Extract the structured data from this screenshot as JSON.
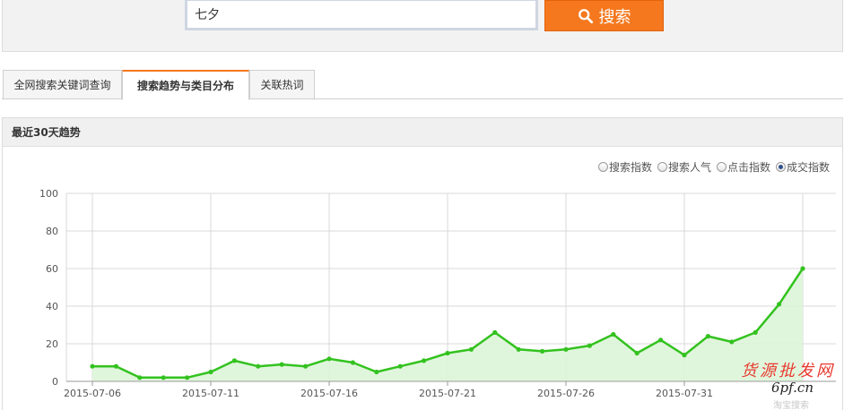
{
  "search": {
    "value": "七夕",
    "button_label": "搜索"
  },
  "tabs": [
    {
      "label": "全网搜索关键词查询",
      "active": false
    },
    {
      "label": "搜索趋势与类目分布",
      "active": true
    },
    {
      "label": "关联热词",
      "active": false
    }
  ],
  "trend": {
    "title": "最近30天趋势",
    "metric_options": [
      {
        "label": "搜索指数",
        "checked": false
      },
      {
        "label": "搜索人气",
        "checked": false
      },
      {
        "label": "点击指数",
        "checked": false
      },
      {
        "label": "成交指数",
        "checked": true
      }
    ]
  },
  "colors": {
    "accent": "#f5781e",
    "line": "#33c21f",
    "area": "#dbf5d6"
  },
  "chart_data": {
    "type": "area",
    "x": [
      "2015-07-06",
      "2015-07-07",
      "2015-07-08",
      "2015-07-09",
      "2015-07-10",
      "2015-07-11",
      "2015-07-12",
      "2015-07-13",
      "2015-07-14",
      "2015-07-15",
      "2015-07-16",
      "2015-07-17",
      "2015-07-18",
      "2015-07-19",
      "2015-07-20",
      "2015-07-21",
      "2015-07-22",
      "2015-07-23",
      "2015-07-24",
      "2015-07-25",
      "2015-07-26",
      "2015-07-27",
      "2015-07-28",
      "2015-07-29",
      "2015-07-30",
      "2015-07-31",
      "2015-08-01",
      "2015-08-02",
      "2015-08-03",
      "2015-08-04"
    ],
    "values": [
      8,
      8,
      2,
      2,
      2,
      5,
      11,
      8,
      9,
      8,
      12,
      10,
      5,
      8,
      11,
      15,
      17,
      26,
      17,
      16,
      17,
      19,
      25,
      15,
      22,
      14,
      24,
      21,
      26,
      41,
      60
    ],
    "x_tick_labels": [
      "2015-07-06",
      "2015-07-11",
      "2015-07-16",
      "2015-07-21",
      "2015-07-26",
      "2015-07-31"
    ],
    "y_ticks": [
      0,
      20,
      40,
      60,
      80,
      100
    ],
    "ylim": [
      0,
      100
    ],
    "grid": true,
    "legend": "none"
  },
  "watermark": {
    "line1": "货源批发网",
    "line2": "6pf.cn",
    "line3": "淘宝搜索"
  }
}
